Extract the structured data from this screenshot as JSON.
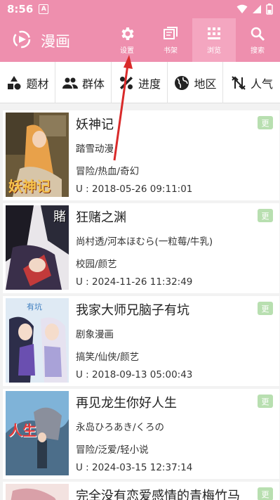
{
  "status": {
    "time": "8:56",
    "notif": "A"
  },
  "app": {
    "title": "漫画"
  },
  "actions": [
    {
      "label": "设置",
      "icon": "gear-icon"
    },
    {
      "label": "书架",
      "icon": "bookshelf-icon"
    },
    {
      "label": "浏览",
      "icon": "browse-grid-icon"
    },
    {
      "label": "搜索",
      "icon": "search-icon"
    }
  ],
  "filters": [
    {
      "label": "题材",
      "icon": "shapes-icon"
    },
    {
      "label": "群体",
      "icon": "group-icon"
    },
    {
      "label": "进度",
      "icon": "percent-icon"
    },
    {
      "label": "地区",
      "icon": "globe-icon"
    },
    {
      "label": "人气",
      "icon": "sort-icon"
    }
  ],
  "comics": [
    {
      "title": "妖神记",
      "author": "踏雪动漫",
      "tags": "冒险/热血/奇幻",
      "updated": "U : 2018-05-26 09:11:01",
      "badge": "更",
      "cover_text": "妖神记"
    },
    {
      "title": "狂赌之渊",
      "author": "尚村透/河本ほむら(一粒莓/牛乳)",
      "tags": "校园/颜艺",
      "updated": "U : 2024-11-26 11:32:49",
      "badge": "更",
      "cover_text": "賭"
    },
    {
      "title": "我家大师兄脑子有坑",
      "author": "剧象漫画",
      "tags": "搞笑/仙侠/颜艺",
      "updated": "U : 2018-09-13 05:00:43",
      "badge": "更",
      "cover_text": "有坑"
    },
    {
      "title": "再见龙生你好人生",
      "author": "永岛ひろあき/くろの",
      "tags": "冒险/泛爱/轻小说",
      "updated": "U : 2024-03-15 12:37:14",
      "badge": "更",
      "cover_text": "人生"
    },
    {
      "title": "完全没有恋爱感情的青梅竹马",
      "author": "",
      "tags": "",
      "updated": "",
      "badge": "更",
      "cover_text": ""
    }
  ]
}
